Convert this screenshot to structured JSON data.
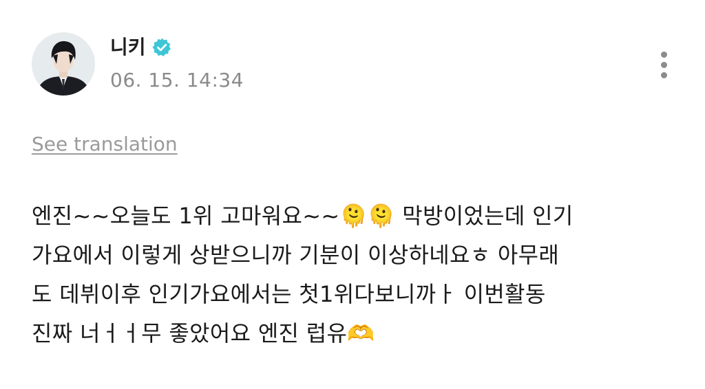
{
  "post": {
    "author_name": "니키",
    "timestamp": "06. 15. 14:34",
    "see_translation_label": "See translation",
    "body_text": "엔진~~오늘도 1위 고마워요~~🫠🫠 막방이었는데 인기\n가요에서 이렇게 상받으니까 기분이 이상하네요ㅎ 아무래\n도 데뷔이후 인기가요에서는 첫1위다보니까ㅏ 이번활동\n진짜 너ㅓㅓ무 좋았어요 엔진 럽유🫶",
    "icons": {
      "verified": "verified-badge-icon",
      "more": "more-vertical-icon",
      "avatar": "profile-avatar"
    },
    "colors": {
      "verified_badge": "#3ec6d6",
      "timestamp": "#8a8a8a",
      "translation_link": "#9a9a9a"
    }
  }
}
